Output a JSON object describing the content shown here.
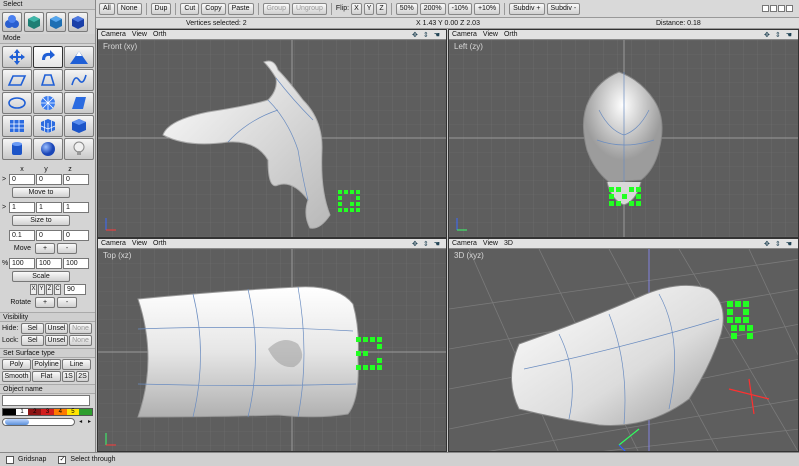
{
  "left": {
    "select_label": "Select",
    "mode_label": "Mode",
    "axis_headers": [
      "x",
      "y",
      "z"
    ],
    "move_to": {
      "values": [
        "0",
        "0",
        "0"
      ],
      "label": "Move to"
    },
    "size_to": {
      "values": [
        "1",
        "1",
        "1"
      ],
      "label": "Size to"
    },
    "move": {
      "values": [
        "0.1",
        "0",
        "0"
      ],
      "label": "Move",
      "plus": "+",
      "minus": "-"
    },
    "scale": {
      "prefix": "%",
      "values": [
        "100",
        "100",
        "100"
      ],
      "label": "Scale"
    },
    "rotate": {
      "axes": [
        "X",
        "Y",
        "Z",
        "C"
      ],
      "value": "90",
      "label": "Rotate",
      "plus": "+",
      "minus": "-"
    },
    "visibility_label": "Visibility",
    "hide": {
      "label": "Hide:",
      "sel": "Sel",
      "unsel": "Unsel",
      "none": "None"
    },
    "lock": {
      "label": "Lock:",
      "sel": "Sel",
      "unsel": "Unsel",
      "none": "None"
    },
    "surface_label": "Set Surface type",
    "surface_row1": [
      "Poly",
      "Polyline",
      "Line"
    ],
    "surface_row2": [
      "Smooth",
      "Flat",
      "1S",
      "2S"
    ],
    "object_name_label": "Object name",
    "palette": [
      {
        "label": "",
        "color": "#000000"
      },
      {
        "label": "1",
        "color": "#ffffff"
      },
      {
        "label": "2",
        "color": "#8c1414"
      },
      {
        "label": "3",
        "color": "#d21e1e"
      },
      {
        "label": "4",
        "color": "#ff7a00"
      },
      {
        "label": "5",
        "color": "#ffe400"
      },
      {
        "label": "",
        "color": "#2e9e2e"
      }
    ],
    "slider_left": "◂",
    "slider_right": "▸"
  },
  "topbar": {
    "all": "All",
    "none": "None",
    "dup": "Dup",
    "cut": "Cut",
    "copy": "Copy",
    "paste": "Paste",
    "group": "Group",
    "ungroup": "Ungroup",
    "flip_label": "Flip:",
    "flip_x": "X",
    "flip_y": "Y",
    "flip_z": "Z",
    "p50": "50%",
    "p200": "200%",
    "m10": "-10%",
    "p10": "+10%",
    "subdiv_plus": "Subdiv +",
    "subdiv_minus": "Subdiv -"
  },
  "status": {
    "vertices": "Vertices selected: 2",
    "coords": "X 1.43 Y 0.00 Z 2.03",
    "distance": "Distance: 0.18"
  },
  "viewports": {
    "front": {
      "menu": [
        "Camera",
        "View",
        "Orth"
      ],
      "title": "Front (xy)"
    },
    "left": {
      "menu": [
        "Camera",
        "View",
        "Orth"
      ],
      "title": "Left (zy)"
    },
    "top": {
      "menu": [
        "Camera",
        "View",
        "Orth"
      ],
      "title": "Top (xz)"
    },
    "three_d": {
      "menu": [
        "Camera",
        "View",
        "3D"
      ],
      "title": "3D (xyz)"
    }
  },
  "bottom": {
    "gridsnap": "Gridsnap",
    "select_through": "Select through",
    "gridsnap_checked": false,
    "select_through_checked": true
  },
  "colors": {
    "viewport_bg": "#5e5e5e",
    "grid": "#6e6e6e",
    "selection_green": "#22ff22",
    "mesh_white": "#f2f2f2"
  }
}
